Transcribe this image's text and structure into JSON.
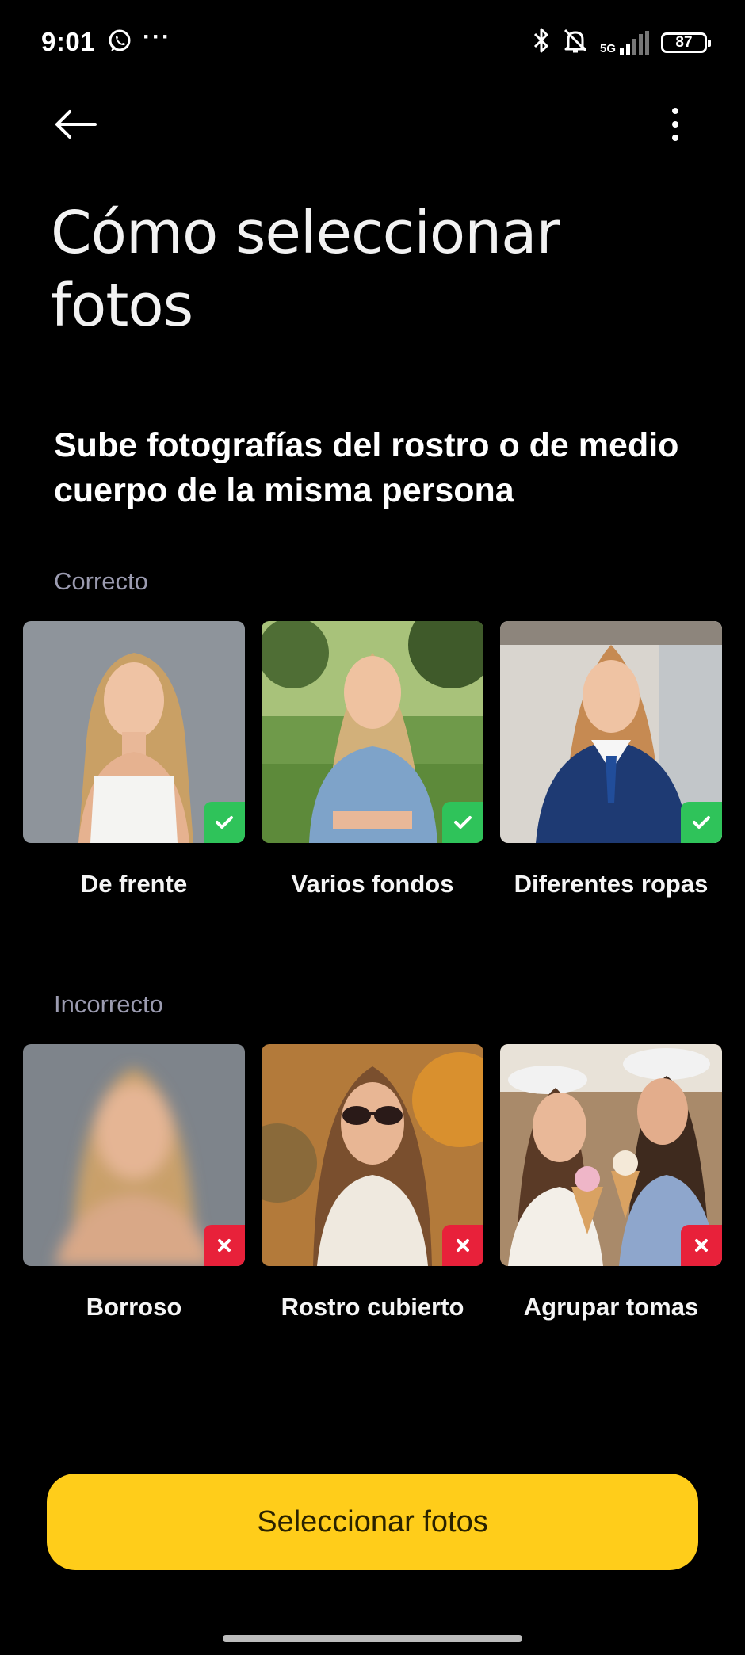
{
  "status_bar": {
    "time": "9:01",
    "more_glyph": "···",
    "network": "5G",
    "battery": "87",
    "icons": [
      "whatsapp-icon",
      "bluetooth-icon",
      "bell-off-icon",
      "signal-icon",
      "battery-icon"
    ]
  },
  "toolbar": {
    "back_icon": "arrow-left-icon",
    "menu_icon": "more-vertical-icon"
  },
  "page": {
    "title": "Cómo seleccionar fotos",
    "subtitle": "Sube fotografías del rostro o de medio cuerpo de la misma persona"
  },
  "correct": {
    "label": "Correcto",
    "badge_color": "#2fc35a",
    "items": [
      {
        "label": "De frente"
      },
      {
        "label": "Varios fondos"
      },
      {
        "label": "Diferentes ropas"
      }
    ]
  },
  "incorrect": {
    "label": "Incorrecto",
    "badge_color": "#e8213a",
    "items": [
      {
        "label": "Borroso"
      },
      {
        "label": "Rostro cubierto"
      },
      {
        "label": "Agrupar tomas"
      }
    ]
  },
  "actions": {
    "select_label": "Seleccionar fotos",
    "accent": "#ffcd1a"
  }
}
